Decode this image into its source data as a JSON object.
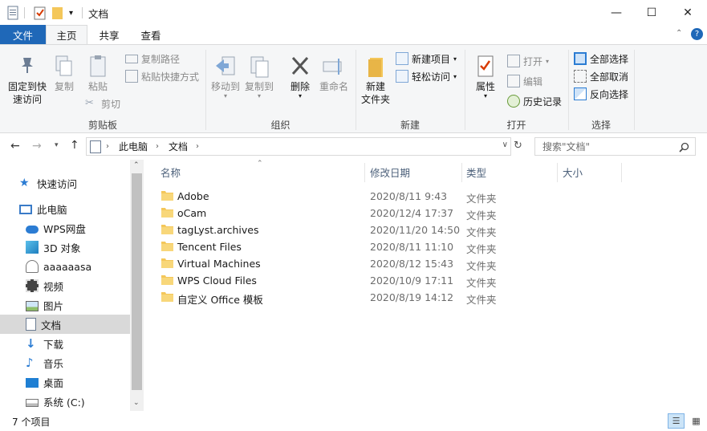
{
  "window": {
    "title": "文档",
    "controls": {
      "minimize": "—",
      "maximize": "☐",
      "close": "✕"
    }
  },
  "tabs": [
    {
      "label": "文件"
    },
    {
      "label": "主页"
    },
    {
      "label": "共享"
    },
    {
      "label": "查看"
    }
  ],
  "help_icon": "?",
  "ribbon": {
    "clipboard": {
      "label": "剪贴板",
      "pin_line1": "固定到快",
      "pin_line2": "速访问",
      "copy": "复制",
      "paste": "粘贴",
      "copy_path": "复制路径",
      "paste_shortcut": "粘贴快捷方式",
      "cut": "剪切"
    },
    "organize": {
      "label": "组织",
      "move_to": "移动到",
      "copy_to": "复制到",
      "delete": "删除",
      "rename": "重命名"
    },
    "new": {
      "label": "新建",
      "new_folder_line1": "新建",
      "new_folder_line2": "文件夹",
      "new_item": "新建项目",
      "easy_access": "轻松访问"
    },
    "open": {
      "label": "打开",
      "properties": "属性",
      "open": "打开",
      "edit": "编辑",
      "history": "历史记录"
    },
    "select": {
      "label": "选择",
      "select_all": "全部选择",
      "select_none": "全部取消",
      "invert": "反向选择"
    }
  },
  "address": {
    "crumbs": [
      "此电脑",
      "文档"
    ],
    "search_placeholder": "搜索\"文档\""
  },
  "nav": [
    {
      "label": "快速访问",
      "icon": "star-icon"
    },
    {
      "label": "此电脑",
      "icon": "computer-icon"
    },
    {
      "label": "WPS网盘",
      "icon": "cloud-icon"
    },
    {
      "label": "3D 对象",
      "icon": "cube-icon"
    },
    {
      "label": "aaaaaasa",
      "icon": "user-icon"
    },
    {
      "label": "视频",
      "icon": "video-icon"
    },
    {
      "label": "图片",
      "icon": "picture-icon"
    },
    {
      "label": "文档",
      "icon": "document-icon"
    },
    {
      "label": "下载",
      "icon": "download-icon"
    },
    {
      "label": "音乐",
      "icon": "music-icon"
    },
    {
      "label": "桌面",
      "icon": "desktop-icon"
    },
    {
      "label": "系统 (C:)",
      "icon": "drive-icon"
    }
  ],
  "columns": {
    "name": "名称",
    "modified": "修改日期",
    "type": "类型",
    "size": "大小"
  },
  "files": [
    {
      "name": "Adobe",
      "modified": "2020/8/11 9:43",
      "type": "文件夹"
    },
    {
      "name": "oCam",
      "modified": "2020/12/4 17:37",
      "type": "文件夹"
    },
    {
      "name": "tagLyst.archives",
      "modified": "2020/11/20 14:50",
      "type": "文件夹"
    },
    {
      "name": "Tencent Files",
      "modified": "2020/8/11 11:10",
      "type": "文件夹"
    },
    {
      "name": "Virtual Machines",
      "modified": "2020/8/12 15:43",
      "type": "文件夹"
    },
    {
      "name": "WPS Cloud Files",
      "modified": "2020/10/9 17:11",
      "type": "文件夹"
    },
    {
      "name": "自定义 Office 模板",
      "modified": "2020/8/19 14:12",
      "type": "文件夹"
    }
  ],
  "status": {
    "count": "7 个项目"
  },
  "colors": {
    "accent": "#1f68b8",
    "folder": "#f4c75a",
    "selected_nav": "#d9d9d9"
  }
}
